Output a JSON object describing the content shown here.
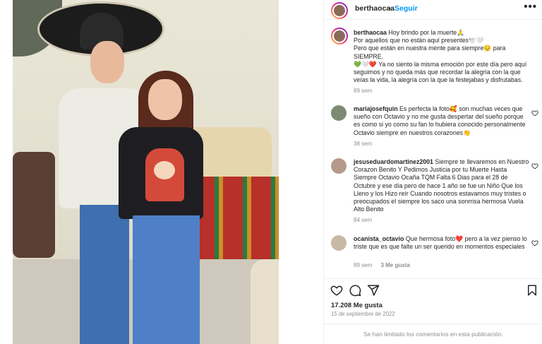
{
  "header": {
    "username": "berthaocaa",
    "separator": "•",
    "follow_label": "Seguir",
    "more_label": "•••"
  },
  "caption": {
    "username": "berthaocaa",
    "line1": "Hoy brindo por la muerte🙏",
    "line2": "Por aquellos que no están aquí presentes🕊️🤍",
    "line3": "Pero que están en nuestra mente para siempre😔 para SIEMPRE.",
    "line4": "💚🤍❤️ Ya no siento la misma emoción por este día pero aquí seguimos y no queda más que recordar la alegría con la que veías la vida, la alegría con la que la festejabas y disfrutabas.",
    "time": "89 sem"
  },
  "comments": [
    {
      "username": "mariajosefquin",
      "text": "Es perfecta la foto🥰 son muchas veces que sueño con Octavio y no me gusta despertar del sueño porque es como si yo como su fan lo hubiera conocido personalmente Octavio siempre en nuestros corazones👏",
      "time": "38 sem",
      "likes": ""
    },
    {
      "username": "jesuseduardomartinez2001",
      "text": "Siempre te llevaremos en Nuestro Corazon Benito Y Pedimos Justicia por tu Muerte Hasta Siempre Octavio Ocaña TQM Falta 6 Dias para el 28 de Octubre y ese día pero de hace 1 año se fue un Niño Que los Lleno y los Hizo reír Cuando nosotros estavamos muy tristes o preocupados el siempre los saco una sonrrisa hermosa Vuela Alto Benito",
      "time": "84 sem",
      "likes": ""
    },
    {
      "username": "ocanista_octavio",
      "text": "Que hermosa foto❤️ pero a la vez pienso lo triste que es que falte un ser querido en momentos especiales",
      "time": "89 sem",
      "likes": "3 Me gusta"
    }
  ],
  "actions": {
    "like_icon": "heart-icon",
    "comment_icon": "comment-icon",
    "share_icon": "share-icon",
    "save_icon": "bookmark-icon"
  },
  "likes_text": "17.208 Me gusta",
  "date_text": "15 de septiembre de 2022",
  "limited_text": "Se han limitado los comentarios en esta publicación.",
  "colors": {
    "accent": "#0095f6",
    "muted": "#8e8e8e",
    "text": "#262626",
    "border": "#efefef"
  }
}
